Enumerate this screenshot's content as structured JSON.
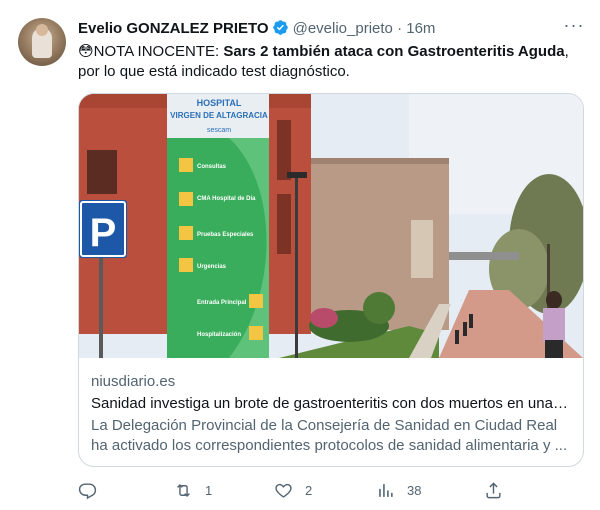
{
  "author": {
    "name": "Evelio GONZALEZ PRIETO",
    "handle": "@evelio_prieto",
    "separator": "·",
    "time": "16m"
  },
  "tweet": {
    "emoji": "😳",
    "lead": "NOTA INOCENTE: ",
    "bold": "Sars 2 también ataca con Gastroenteritis Aguda",
    "rest": ", por lo que está indicado test diagnóstico."
  },
  "card": {
    "domain": "niusdiario.es",
    "title": "Sanidad investiga un brote de gastroenteritis con dos muertos en una r...",
    "description": "La Delegación Provincial de la Consejería de Sanidad en Ciudad Real ha activado los correspondientes protocolos de sanidad alimentaria y ...",
    "image": {
      "sign_hospital_line1": "HOSPITAL",
      "sign_hospital_line2": "VIRGEN DE ALTAGRACIA",
      "sign_brand": "sescam",
      "parking_letter": "P",
      "directory": [
        "Consultas",
        "CMA Hospital de Día",
        "Pruebas Especiales",
        "Urgencias",
        "Entrada Principal",
        "Hospitalización"
      ]
    }
  },
  "actions": {
    "reply_count": "",
    "retweet_count": "1",
    "like_count": "2",
    "views_count": "38"
  },
  "colors": {
    "accent": "#1d9bf0",
    "secondary_text": "#536471",
    "border": "#cfd9de"
  },
  "icons": [
    "verified-badge-icon",
    "more-icon",
    "reply-icon",
    "retweet-icon",
    "like-icon",
    "views-icon",
    "share-icon"
  ]
}
